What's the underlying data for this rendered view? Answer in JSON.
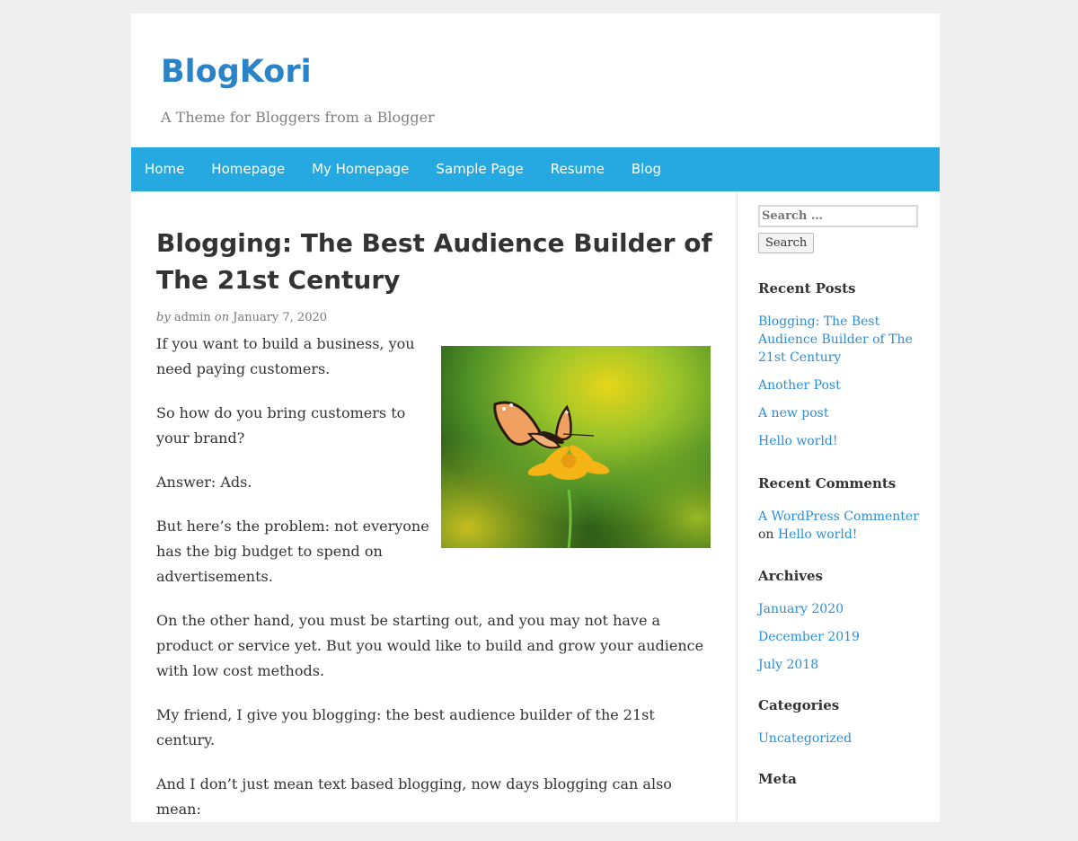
{
  "site": {
    "title": "BlogKori",
    "tagline": "A Theme for Bloggers from a Blogger"
  },
  "nav": [
    "Home",
    "Homepage",
    "My Homepage",
    "Sample Page",
    "Resume",
    "Blog"
  ],
  "post": {
    "title": "Blogging: The Best Audience Builder of The 21st Century",
    "by": "by",
    "author": "admin",
    "on": "on",
    "date": "January 7, 2020",
    "paragraphs": [
      "If you want to build a business, you need paying customers.",
      "So how do you bring customers to your brand?",
      "Answer: Ads.",
      "But here’s the problem: not everyone has the big budget to spend on advertisements.",
      "On the other hand, you must be starting out, and you may not have a product or service yet. But you would like to build and grow your audience with low cost methods.",
      "My friend, I give you blogging: the best audience builder of the 21st century.",
      "And I don’t just mean text based blogging, now days blogging can also mean:"
    ]
  },
  "sidebar": {
    "search_placeholder": "Search …",
    "search_button": "Search",
    "recent_posts_title": "Recent Posts",
    "recent_posts": [
      "Blogging: The Best Audience Builder of The 21st Century",
      "Another Post",
      "A new post",
      "Hello world!"
    ],
    "recent_comments_title": "Recent Comments",
    "comment": {
      "author": "A WordPress Commenter",
      "on": "on",
      "post": "Hello world!"
    },
    "archives_title": "Archives",
    "archives": [
      "January 2020",
      "December 2019",
      "July 2018"
    ],
    "categories_title": "Categories",
    "categories": [
      "Uncategorized"
    ],
    "meta_title": "Meta"
  },
  "colors": {
    "accent": "#26a8e0",
    "title": "#2a82c7",
    "link": "#2a8ed6",
    "background": "#efefef"
  }
}
